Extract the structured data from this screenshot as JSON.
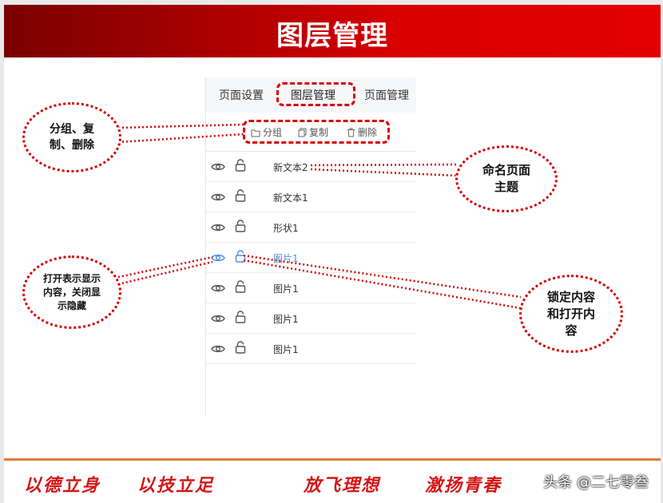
{
  "title": "图层管理",
  "tabs": [
    {
      "label": "页面设置"
    },
    {
      "label": "图层管理"
    },
    {
      "label": "页面管理"
    }
  ],
  "toolbar": {
    "group_label": "分组",
    "copy_label": "复制",
    "delete_label": "删除"
  },
  "layers": [
    {
      "name": "新文本2",
      "selected": false
    },
    {
      "name": "新文本1",
      "selected": false
    },
    {
      "name": "形状1",
      "selected": false
    },
    {
      "name": "图片1",
      "selected": true
    },
    {
      "name": "图片1",
      "selected": false
    },
    {
      "name": "图片1",
      "selected": false
    },
    {
      "name": "图片1",
      "selected": false
    }
  ],
  "annotations": {
    "group_copy_delete": "分组、复制、删除",
    "rename": "命名页面主题",
    "visibility": "打开表示显示内容，关闭显示隐藏",
    "lock": "锁定内容和打开内容"
  },
  "slogans": [
    "以德立身",
    "以技立足",
    "放飞理想",
    "激扬青春"
  ],
  "watermark": "头条 @二七零叁",
  "colors": {
    "banner_red": "#d80000",
    "annotation_red": "#d40000",
    "selected_blue": "#4a90e2",
    "divider_orange": "#e07b39"
  }
}
